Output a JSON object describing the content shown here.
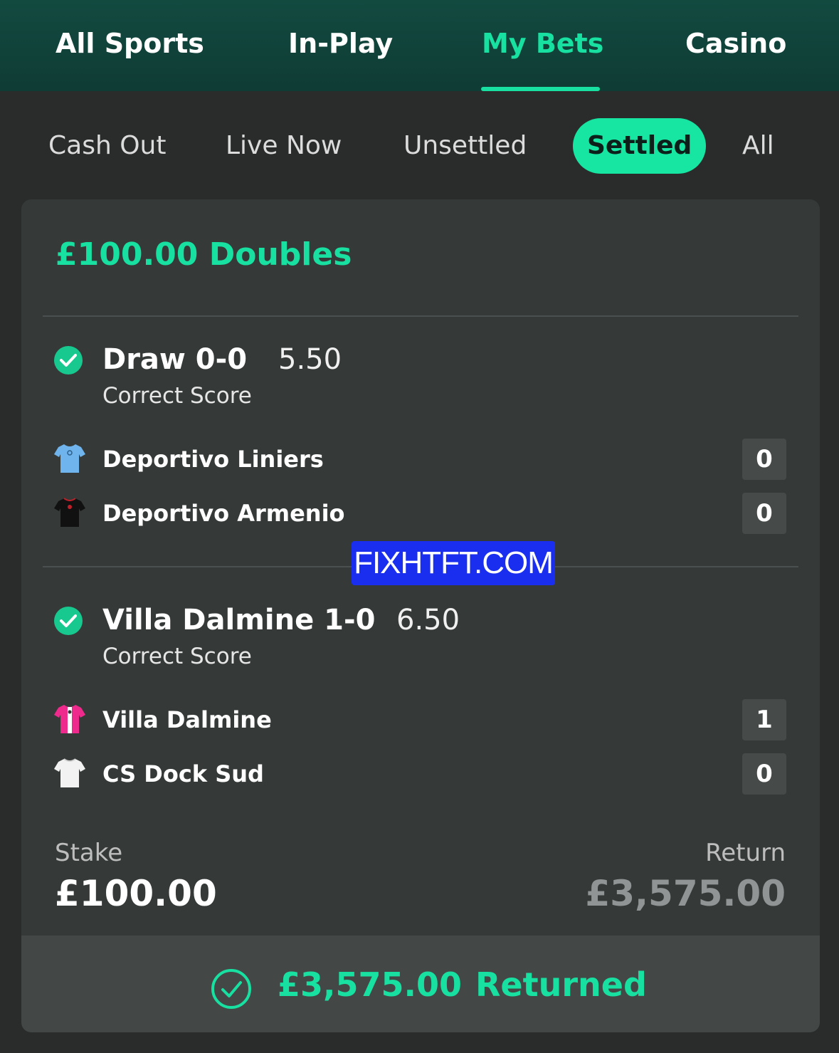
{
  "top_nav": {
    "tabs": [
      {
        "label": "All Sports",
        "active": false
      },
      {
        "label": "In-Play",
        "active": false
      },
      {
        "label": "My Bets",
        "active": true
      },
      {
        "label": "Casino",
        "active": false
      }
    ]
  },
  "sub_nav": {
    "tabs": [
      {
        "label": "Cash Out",
        "active": false
      },
      {
        "label": "Live Now",
        "active": false
      },
      {
        "label": "Unsettled",
        "active": false
      },
      {
        "label": "Settled",
        "active": true
      },
      {
        "label": "All",
        "active": false
      }
    ]
  },
  "bet": {
    "title": "£100.00 Doubles",
    "selections": [
      {
        "name": "Draw 0-0",
        "odds": "5.50",
        "market": "Correct Score",
        "status": "won",
        "teams": [
          {
            "name": "Deportivo Liniers",
            "score": "0",
            "kit_icon": "light-blue-shirt-icon",
            "kit_color": "#6fb4ec"
          },
          {
            "name": "Deportivo Armenio",
            "score": "0",
            "kit_icon": "black-shirt-icon",
            "kit_color": "#111111"
          }
        ]
      },
      {
        "name": "Villa Dalmine 1-0",
        "odds": "6.50",
        "market": "Correct Score",
        "status": "won",
        "teams": [
          {
            "name": "Villa Dalmine",
            "score": "1",
            "kit_icon": "pink-shirt-icon",
            "kit_color": "#ee2a8d"
          },
          {
            "name": "CS Dock Sud",
            "score": "0",
            "kit_icon": "white-shirt-icon",
            "kit_color": "#f2f2f2"
          }
        ]
      }
    ],
    "stake_label": "Stake",
    "stake_value": "£100.00",
    "return_label": "Return",
    "return_value": "£3,575.00",
    "returned_amount": "£3,575.00",
    "returned_word": "Returned"
  },
  "watermark": "FIXHTFT.COM",
  "colors": {
    "accent": "#17e0a0",
    "nav_bg": "#124a40",
    "card_bg": "#353a39",
    "watermark_bg": "#1a2ef0"
  }
}
